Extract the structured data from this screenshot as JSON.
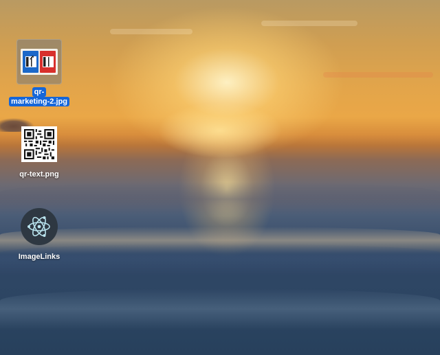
{
  "desktop": {
    "wallpaper": "sunset-over-ocean",
    "selection_color": "#1566d9",
    "icons": [
      {
        "label_line1": "qr-",
        "label_line2": "marketing-2.jpg",
        "type": "image-file",
        "selected": true
      },
      {
        "label": "qr-text.png",
        "type": "image-file",
        "selected": false
      },
      {
        "label": "ImageLinks",
        "type": "application",
        "icon": "electron-atom-icon",
        "selected": false
      }
    ]
  }
}
